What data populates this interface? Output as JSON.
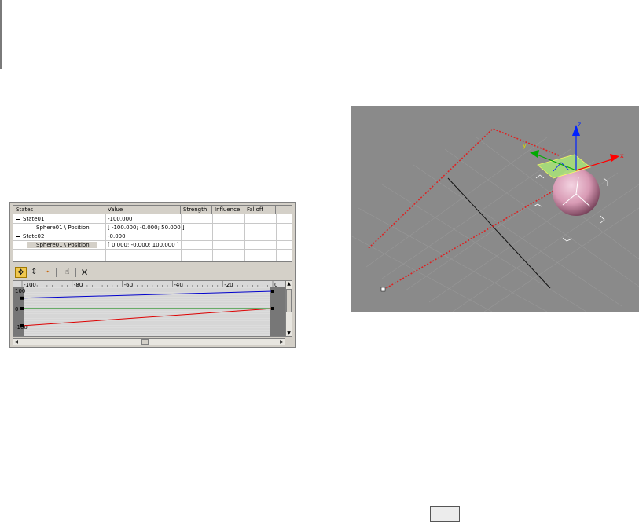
{
  "parameter_collector": {
    "columns": [
      "States",
      "Value",
      "Strength",
      "Influence",
      "Falloff"
    ],
    "rows": [
      {
        "name": "State01",
        "value": "-100.000",
        "expanded": true
      },
      {
        "name": "Sphere01 \\ Position",
        "value": "[ -100.000; -0.000; 50.000 ]"
      },
      {
        "name": "State02",
        "value": "-0.000",
        "expanded": true
      },
      {
        "name": "Sphere01 \\ Position",
        "value": "[ 0.000; -0.000; 100.000 ]",
        "selected": true
      }
    ],
    "toolbar": [
      {
        "icon": "move-keys-icon",
        "active": true
      },
      {
        "icon": "scale-keys-icon"
      },
      {
        "icon": "add-keys-icon"
      },
      {
        "icon": "pan-hand-icon"
      },
      {
        "icon": "delete-icon"
      }
    ],
    "curve_editor": {
      "x_ticks": [
        "-100",
        "-80",
        "-60",
        "-40",
        "-20",
        "0"
      ],
      "y_ticks": [
        "100",
        "0",
        "-100"
      ],
      "curve_colors": {
        "x": "#0000cc",
        "y": "#008800",
        "z": "#dd0000"
      },
      "keys": [
        {
          "curve": "blue",
          "start": 60,
          "end": 100
        },
        {
          "curve": "green",
          "start": 0,
          "end": 0
        },
        {
          "curve": "red",
          "start": -100,
          "end": 0
        }
      ]
    }
  },
  "viewport": {
    "axes": {
      "x": "x",
      "y": "y",
      "z": "z"
    },
    "colors": {
      "background": "#8a8a8a",
      "sphere": "#d89ab4",
      "path": "#dd2222",
      "gizmo_plane": "#a8e07a"
    }
  }
}
